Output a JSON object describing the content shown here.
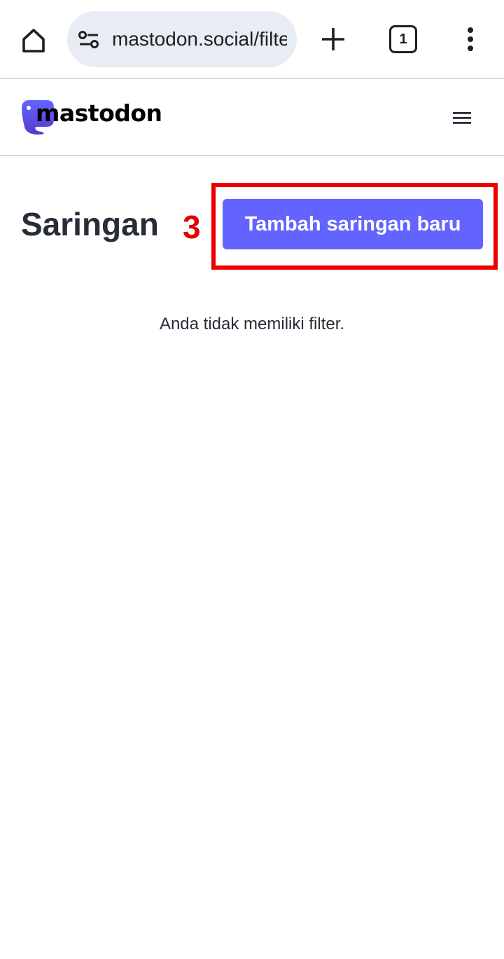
{
  "browser": {
    "url": "mastodon.social/filters",
    "tab_count": "1"
  },
  "site": {
    "logo_text": "mastodon"
  },
  "main": {
    "title": "Saringan",
    "step_number": "3",
    "add_filter_label": "Tambah saringan baru",
    "empty_message": "Anda tidak memiliki filter."
  },
  "colors": {
    "brand": "#6364ff",
    "annotation": "#ee0000",
    "text_dark": "#282c37"
  },
  "icons": {
    "home": "home-icon",
    "site_settings": "tune-icon",
    "new_tab": "plus-icon",
    "overflow": "more-vert-icon",
    "menu": "hamburger-icon"
  }
}
